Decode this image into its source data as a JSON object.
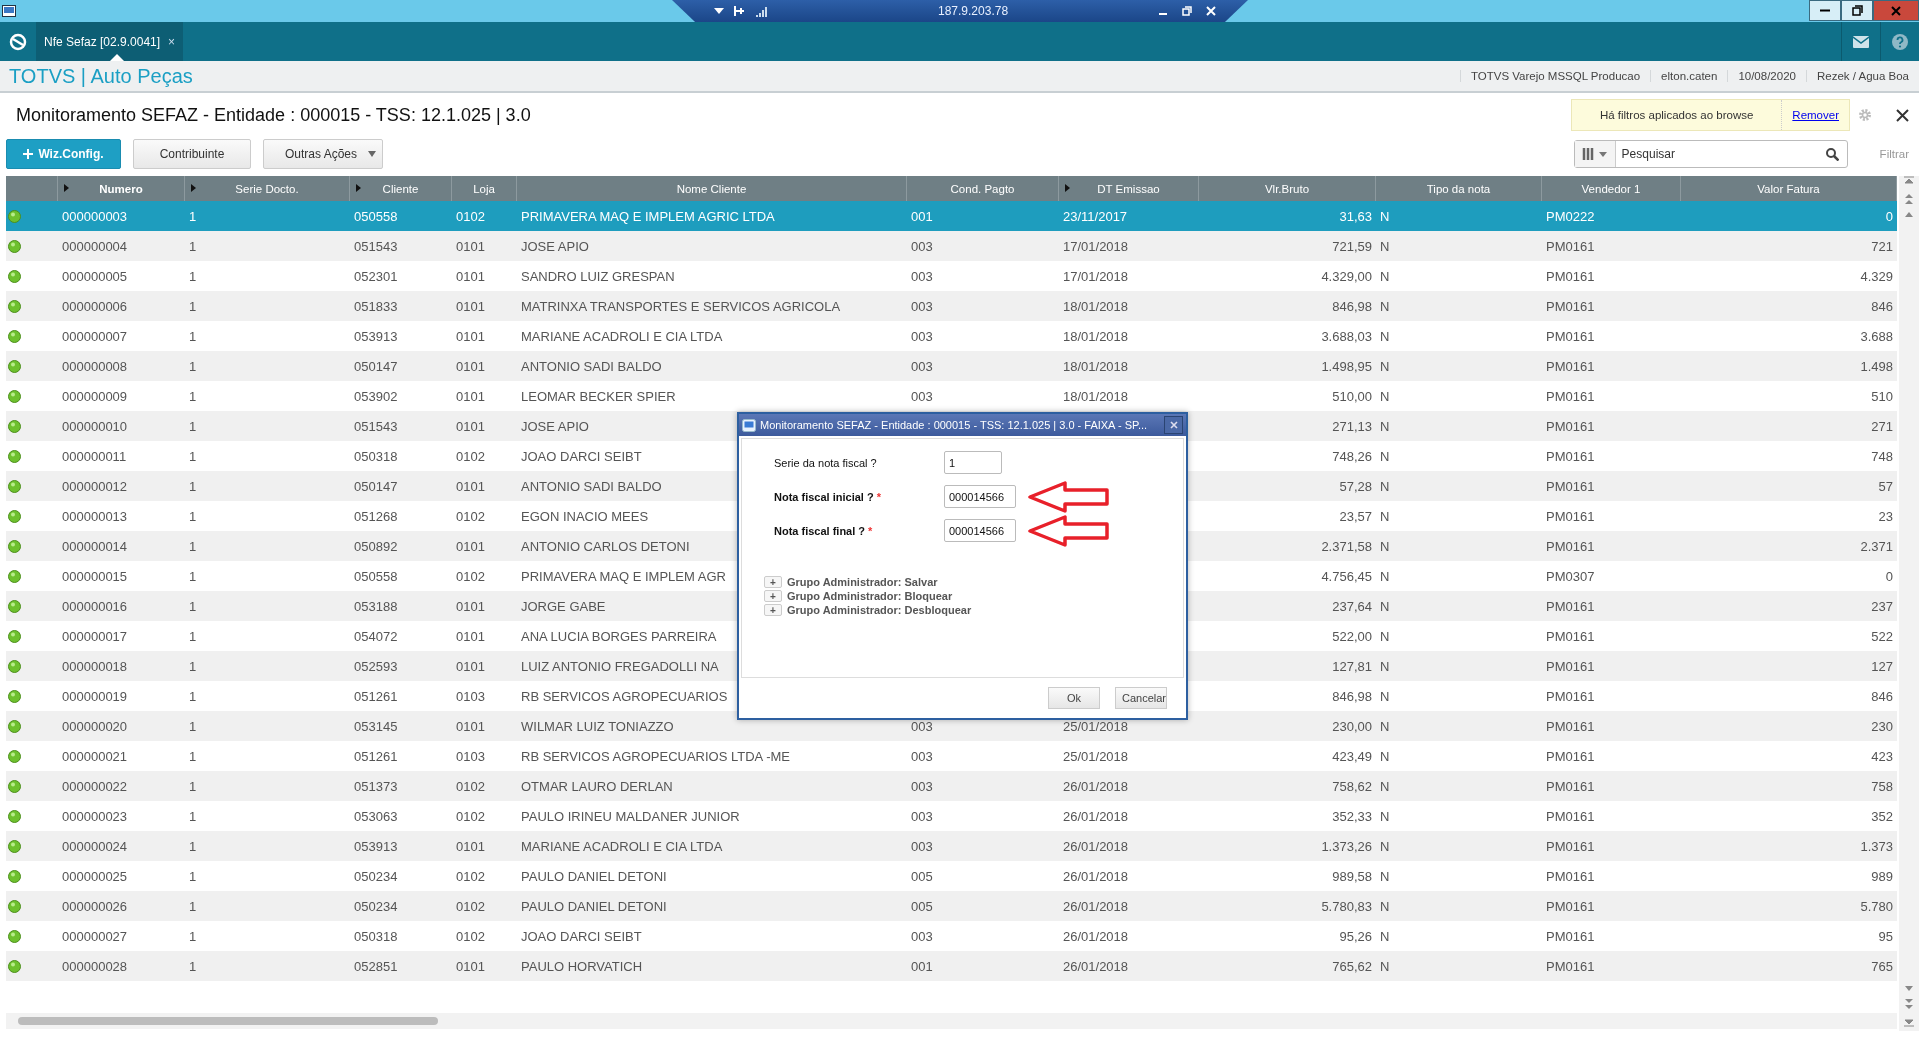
{
  "remote_bar": {
    "address": "187.9.203.78"
  },
  "tabs": [
    {
      "label": "Nfe Sefaz [02.9.0041]",
      "close": "×",
      "selected": true
    }
  ],
  "app_header": {
    "brand": "TOTVS | Auto Peças",
    "info": [
      "TOTVS Varejo MSSQL Producao",
      "elton.caten",
      "10/08/2020",
      "Rezek / Agua Boa"
    ]
  },
  "page_title": "Monitoramento SEFAZ - Entidade : 000015 - TSS: 12.1.025 | 3.0",
  "filter_notice": {
    "text": "Há filtros aplicados ao browse",
    "link": "Remover"
  },
  "buttons": [
    {
      "label": "Wiz.Config.",
      "kind": "primary"
    },
    {
      "label": "Contribuinte",
      "kind": "plain"
    },
    {
      "label": "Outras Ações",
      "kind": "menu"
    }
  ],
  "search": {
    "placeholder": "Pesquisar",
    "filter_label": "Filtrar"
  },
  "table": {
    "columns": [
      {
        "label": "Numero",
        "sortable": true
      },
      {
        "label": "Serie Docto.",
        "sortable": true
      },
      {
        "label": "Cliente",
        "sortable": true
      },
      {
        "label": "Loja",
        "sortable": false
      },
      {
        "label": "Nome Cliente",
        "sortable": false
      },
      {
        "label": "Cond. Pagto",
        "sortable": false
      },
      {
        "label": "DT Emissao",
        "sortable": true
      },
      {
        "label": "Vlr.Bruto",
        "sortable": false
      },
      {
        "label": "Tipo da nota",
        "sortable": false
      },
      {
        "label": "Vendedor 1",
        "sortable": false
      },
      {
        "label": "Valor Fatura",
        "sortable": false
      }
    ],
    "rows": [
      {
        "selected": true,
        "cells": [
          "000000003",
          "1",
          "050558",
          "0102",
          "PRIMAVERA MAQ E IMPLEM AGRIC LTDA",
          "001",
          "23/11/2017",
          "31,63",
          "N",
          "PM0222",
          "0"
        ]
      },
      {
        "selected": false,
        "cells": [
          "000000004",
          "1",
          "051543",
          "0101",
          "JOSE APIO",
          "003",
          "17/01/2018",
          "721,59",
          "N",
          "PM0161",
          "721"
        ]
      },
      {
        "selected": false,
        "cells": [
          "000000005",
          "1",
          "052301",
          "0101",
          "SANDRO LUIZ GRESPAN",
          "003",
          "17/01/2018",
          "4.329,00",
          "N",
          "PM0161",
          "4.329"
        ]
      },
      {
        "selected": false,
        "cells": [
          "000000006",
          "1",
          "051833",
          "0101",
          "MATRINXA TRANSPORTES E SERVICOS AGRICOLA",
          "003",
          "18/01/2018",
          "846,98",
          "N",
          "PM0161",
          "846"
        ]
      },
      {
        "selected": false,
        "cells": [
          "000000007",
          "1",
          "053913",
          "0101",
          "MARIANE ACADROLI E CIA LTDA",
          "003",
          "18/01/2018",
          "3.688,03",
          "N",
          "PM0161",
          "3.688"
        ]
      },
      {
        "selected": false,
        "cells": [
          "000000008",
          "1",
          "050147",
          "0101",
          "ANTONIO SADI BALDO",
          "003",
          "18/01/2018",
          "1.498,95",
          "N",
          "PM0161",
          "1.498"
        ]
      },
      {
        "selected": false,
        "cells": [
          "000000009",
          "1",
          "053902",
          "0101",
          "LEOMAR BECKER SPIER",
          "003",
          "18/01/2018",
          "510,00",
          "N",
          "PM0161",
          "510"
        ]
      },
      {
        "selected": false,
        "cells": [
          "000000010",
          "1",
          "051543",
          "0101",
          "JOSE APIO",
          "",
          "",
          "271,13",
          "N",
          "PM0161",
          "271"
        ]
      },
      {
        "selected": false,
        "cells": [
          "000000011",
          "1",
          "050318",
          "0102",
          "JOAO DARCI SEIBT",
          "",
          "",
          "748,26",
          "N",
          "PM0161",
          "748"
        ]
      },
      {
        "selected": false,
        "cells": [
          "000000012",
          "1",
          "050147",
          "0101",
          "ANTONIO SADI BALDO",
          "",
          "",
          "57,28",
          "N",
          "PM0161",
          "57"
        ]
      },
      {
        "selected": false,
        "cells": [
          "000000013",
          "1",
          "051268",
          "0102",
          "EGON INACIO MEES",
          "",
          "",
          "23,57",
          "N",
          "PM0161",
          "23"
        ]
      },
      {
        "selected": false,
        "cells": [
          "000000014",
          "1",
          "050892",
          "0101",
          "ANTONIO CARLOS DETONI",
          "",
          "",
          "2.371,58",
          "N",
          "PM0161",
          "2.371"
        ]
      },
      {
        "selected": false,
        "cells": [
          "000000015",
          "1",
          "050558",
          "0102",
          "PRIMAVERA MAQ E IMPLEM AGR",
          "",
          "",
          "4.756,45",
          "N",
          "PM0307",
          "0"
        ]
      },
      {
        "selected": false,
        "cells": [
          "000000016",
          "1",
          "053188",
          "0101",
          "JORGE GABE",
          "",
          "",
          "237,64",
          "N",
          "PM0161",
          "237"
        ]
      },
      {
        "selected": false,
        "cells": [
          "000000017",
          "1",
          "054072",
          "0101",
          "ANA LUCIA BORGES PARREIRA",
          "",
          "",
          "522,00",
          "N",
          "PM0161",
          "522"
        ]
      },
      {
        "selected": false,
        "cells": [
          "000000018",
          "1",
          "052593",
          "0101",
          "LUIZ ANTONIO FREGADOLLI NA",
          "",
          "",
          "127,81",
          "N",
          "PM0161",
          "127"
        ]
      },
      {
        "selected": false,
        "cells": [
          "000000019",
          "1",
          "051261",
          "0103",
          "RB SERVICOS AGROPECUARIOS",
          "",
          "",
          "846,98",
          "N",
          "PM0161",
          "846"
        ]
      },
      {
        "selected": false,
        "cells": [
          "000000020",
          "1",
          "053145",
          "0101",
          "WILMAR LUIZ TONIAZZO",
          "003",
          "25/01/2018",
          "230,00",
          "N",
          "PM0161",
          "230"
        ]
      },
      {
        "selected": false,
        "cells": [
          "000000021",
          "1",
          "051261",
          "0103",
          "RB SERVICOS AGROPECUARIOS LTDA -ME",
          "003",
          "25/01/2018",
          "423,49",
          "N",
          "PM0161",
          "423"
        ]
      },
      {
        "selected": false,
        "cells": [
          "000000022",
          "1",
          "051373",
          "0102",
          "OTMAR LAURO DERLAN",
          "003",
          "26/01/2018",
          "758,62",
          "N",
          "PM0161",
          "758"
        ]
      },
      {
        "selected": false,
        "cells": [
          "000000023",
          "1",
          "053063",
          "0102",
          "PAULO IRINEU MALDANER JUNIOR",
          "003",
          "26/01/2018",
          "352,33",
          "N",
          "PM0161",
          "352"
        ]
      },
      {
        "selected": false,
        "cells": [
          "000000024",
          "1",
          "053913",
          "0101",
          "MARIANE ACADROLI E CIA LTDA",
          "003",
          "26/01/2018",
          "1.373,26",
          "N",
          "PM0161",
          "1.373"
        ]
      },
      {
        "selected": false,
        "cells": [
          "000000025",
          "1",
          "050234",
          "0102",
          "PAULO DANIEL DETONI",
          "005",
          "26/01/2018",
          "989,58",
          "N",
          "PM0161",
          "989"
        ]
      },
      {
        "selected": false,
        "cells": [
          "000000026",
          "1",
          "050234",
          "0102",
          "PAULO DANIEL DETONI",
          "005",
          "26/01/2018",
          "5.780,83",
          "N",
          "PM0161",
          "5.780"
        ]
      },
      {
        "selected": false,
        "cells": [
          "000000027",
          "1",
          "050318",
          "0102",
          "JOAO DARCI SEIBT",
          "003",
          "26/01/2018",
          "95,26",
          "N",
          "PM0161",
          "95"
        ]
      },
      {
        "selected": false,
        "cells": [
          "000000028",
          "1",
          "052851",
          "0101",
          "PAULO HORVATICH",
          "001",
          "26/01/2018",
          "765,62",
          "N",
          "PM0161",
          "765"
        ]
      }
    ]
  },
  "dialog": {
    "title": "Monitoramento SEFAZ - Entidade : 000015 - TSS: 12.1.025 | 3.0 - FAIXA - SP...",
    "fields": [
      {
        "label": "Serie da nota fiscal ?",
        "required": false,
        "value": "1",
        "marked": false
      },
      {
        "label": "Nota fiscal inicial ?",
        "required": true,
        "required_mark": "*",
        "value": "000014566",
        "marked": true
      },
      {
        "label": "Nota fiscal final ?",
        "required": true,
        "required_mark": "*",
        "value": "000014566",
        "marked": true
      }
    ],
    "groups": [
      {
        "toggle": "+",
        "label": "Grupo Administrador: Salvar",
        "expanded": false
      },
      {
        "toggle": "+",
        "label": "Grupo Administrador: Bloquear",
        "expanded": false
      },
      {
        "toggle": "+",
        "label": "Grupo Administrador: Desbloquear",
        "expanded": false
      }
    ],
    "buttons": [
      "Ok",
      "Cancelar"
    ]
  }
}
